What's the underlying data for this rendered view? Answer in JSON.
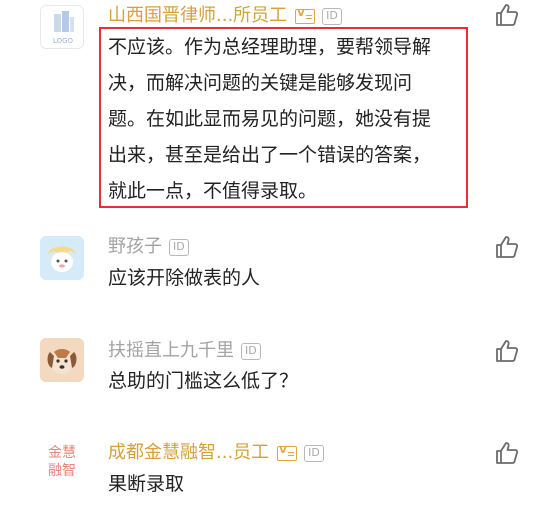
{
  "comments": [
    {
      "user": "山西国晋律师...所员工",
      "verified": true,
      "id_badge": "ID",
      "avatar_text": "LOGO",
      "text_lines": [
        "不应该。作为总经理助理，要帮领导解",
        "决，而解决问题的关键是能够发现问",
        "题。在如此显而易见的问题，她没有提",
        "出来，甚至是给出了一个错误的答案，",
        "就此一点，不值得录取。"
      ],
      "highlighted": true
    },
    {
      "user": "野孩子",
      "verified": false,
      "id_badge": "ID",
      "text": "应该开除做表的人"
    },
    {
      "user": "扶摇直上九千里",
      "verified": false,
      "id_badge": "ID",
      "text": "总助的门槛这么低了？"
    },
    {
      "user": "成都金慧融智...员工",
      "verified": true,
      "id_badge": "ID",
      "avatar_text": [
        "金慧",
        "融智"
      ],
      "text": "果断录取"
    }
  ],
  "colors": {
    "verified_name": "#d4a23a",
    "normal_name": "#a3a3a3",
    "highlight_border": "#e5303a",
    "body_text": "#222222"
  },
  "icons": [
    "thumbs-up-icon",
    "verified-v-icon"
  ]
}
